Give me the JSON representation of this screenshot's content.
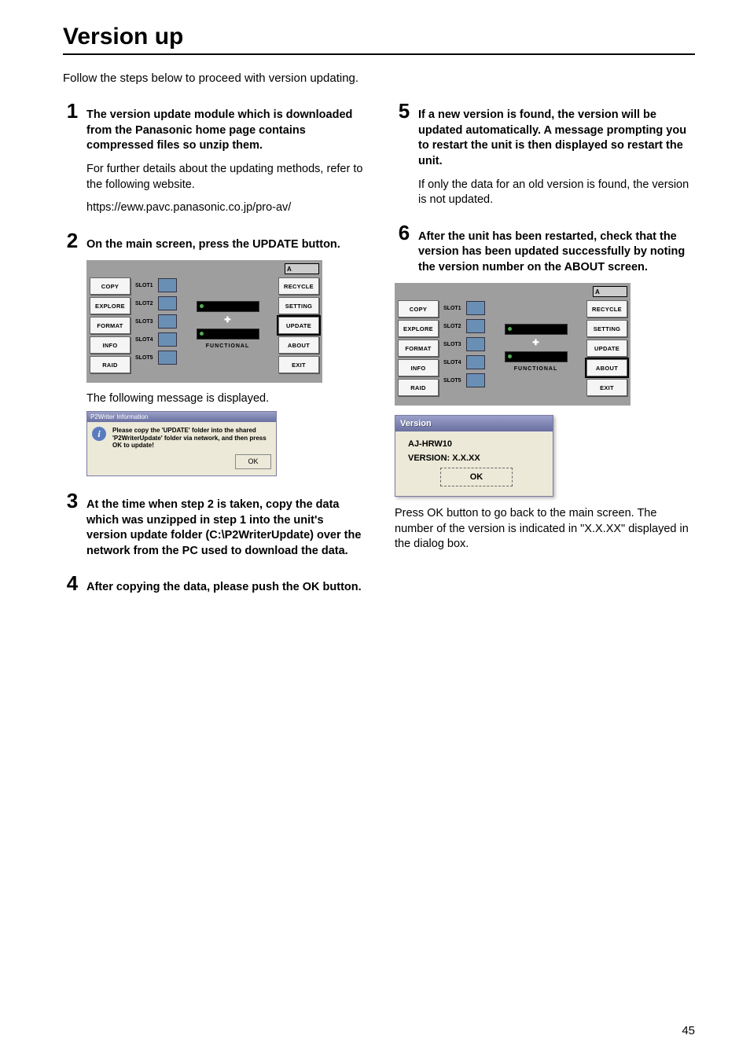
{
  "page_number": "45",
  "title": "Version up",
  "intro": "Follow the steps below to proceed with version updating.",
  "steps": {
    "s1": {
      "num": "1",
      "bold": "The version update module which is downloaded from the Panasonic home page contains compressed files so unzip them.",
      "sub1": "For further details about the updating methods, refer to the following website.",
      "url": "https://eww.pavc.panasonic.co.jp/pro-av/"
    },
    "s2": {
      "num": "2",
      "bold": "On the main screen, press the UPDATE button.",
      "after": "The following message is displayed."
    },
    "s3": {
      "num": "3",
      "bold": "At the time when step 2 is taken, copy the data which was unzipped in step 1 into the unit's version update folder (C:\\P2WriterUpdate) over the network from the PC used to download the data."
    },
    "s4": {
      "num": "4",
      "bold": "After copying the data, please push the OK button."
    },
    "s5": {
      "num": "5",
      "bold": "If a new version is found, the version will be updated automatically.  A message prompting you to restart the unit is then displayed so restart the unit.",
      "sub": "If only the data for an old version is found, the version is not updated."
    },
    "s6": {
      "num": "6",
      "bold": "After the unit has been restarted, check that the version has been updated successfully by noting the version number on the ABOUT screen.",
      "after1": "Press OK button to go back to the main screen.",
      "after2": "The number of the version is indicated in \"X.X.XX\" displayed in the dialog box."
    }
  },
  "screen": {
    "left": [
      "COPY",
      "EXPLORE",
      "FORMAT",
      "INFO",
      "RAID"
    ],
    "right": [
      "RECYCLE",
      "SETTING",
      "UPDATE",
      "ABOUT",
      "EXIT"
    ],
    "slots": [
      "SLOT1",
      "SLOT2",
      "SLOT3",
      "SLOT4",
      "SLOT5"
    ],
    "functional": "FUNCTIONAL"
  },
  "dialog": {
    "title": "P2Writer Information",
    "text": "Please copy the 'UPDATE' folder into the shared 'P2WriterUpdate' folder via network, and then press OK to update!",
    "ok": "OK"
  },
  "vdialog": {
    "title": "Version",
    "line1": "AJ-HRW10",
    "line2": "VERSION: X.X.XX",
    "ok": "OK"
  }
}
